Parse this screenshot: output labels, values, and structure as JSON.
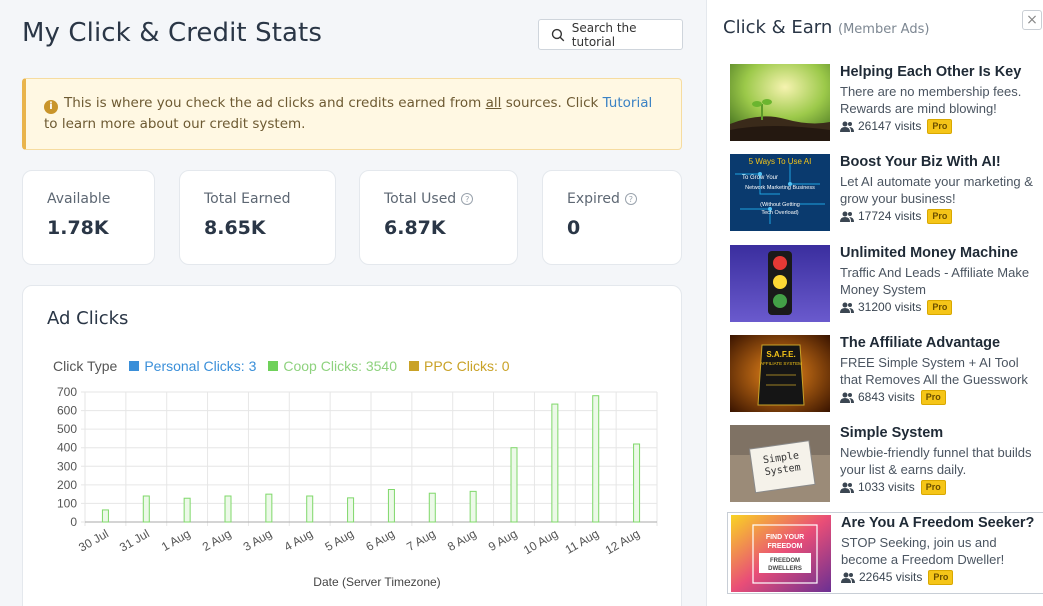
{
  "page": {
    "title": "My Click & Credit Stats"
  },
  "search": {
    "label": "Search the tutorial"
  },
  "alert": {
    "text_before": "This is where you check the ad clicks and credits earned from ",
    "underlined": "all",
    "text_mid": " sources. Click ",
    "link": "Tutorial",
    "text_after": " to learn more about our credit system."
  },
  "stats": [
    {
      "label": "Available",
      "value": "1.78K",
      "help": false
    },
    {
      "label": "Total Earned",
      "value": "8.65K",
      "help": false
    },
    {
      "label": "Total Used",
      "value": "6.87K",
      "help": true
    },
    {
      "label": "Expired",
      "value": "0",
      "help": true
    }
  ],
  "chart": {
    "title": "Ad Clicks",
    "legend_title": "Click Type",
    "legend": [
      {
        "label": "Personal Clicks: 3",
        "color": "#3a8fd9",
        "text_color": "#3a8fd9"
      },
      {
        "label": "Coop Clicks: 3540",
        "color": "#6fd15a",
        "text_color": "#8ed27e"
      },
      {
        "label": "PPC Clicks: 0",
        "color": "#c9a227",
        "text_color": "#c9a227"
      }
    ]
  },
  "chart_data": {
    "type": "bar",
    "categories": [
      "30 Jul",
      "31 Jul",
      "1 Aug",
      "2 Aug",
      "3 Aug",
      "4 Aug",
      "5 Aug",
      "6 Aug",
      "7 Aug",
      "8 Aug",
      "9 Aug",
      "10 Aug",
      "11 Aug",
      "12 Aug"
    ],
    "series": [
      {
        "name": "Personal Clicks",
        "values": [
          0,
          0,
          0,
          0,
          0,
          0,
          0,
          0,
          0,
          0,
          0,
          0,
          0,
          0
        ]
      },
      {
        "name": "Coop Clicks",
        "values": [
          65,
          140,
          128,
          140,
          150,
          140,
          130,
          175,
          155,
          165,
          400,
          635,
          680,
          420
        ]
      },
      {
        "name": "PPC Clicks",
        "values": [
          0,
          0,
          0,
          0,
          0,
          0,
          0,
          0,
          0,
          0,
          0,
          0,
          0,
          0
        ]
      }
    ],
    "xlabel": "Date (Server Timezone)",
    "ylabel": "",
    "ylim": [
      0,
      700
    ],
    "yticks": [
      0,
      100,
      200,
      300,
      400,
      500,
      600,
      700
    ],
    "grid": true
  },
  "sidebar": {
    "title": "Click & Earn",
    "subtitle": "(Member Ads)",
    "close": "×",
    "badge": "Pro",
    "ads": [
      {
        "title": "Helping Each Other Is Key",
        "desc": "There are no membership fees. Rewards are mind blowing!",
        "visits": "26147 visits"
      },
      {
        "title": "Boost Your Biz With AI!",
        "desc": "Let AI automate your marketing & grow your business!",
        "visits": "17724 visits",
        "thumb_text": [
          "5 Ways To Use AI",
          "To Grow Your",
          "Network Marketing Business",
          "(Without Getting",
          "Tech Overload)"
        ]
      },
      {
        "title": "Unlimited Money Machine",
        "desc": "Traffic And Leads - Affiliate Make Money System",
        "visits": "31200 visits"
      },
      {
        "title": "The Affiliate Advantage",
        "desc": "FREE Simple System + AI Tool that Removes All the Guesswork",
        "visits": "6843 visits",
        "thumb_text": [
          "S.A.F.E.",
          "AFFILIATE SYSTEM"
        ]
      },
      {
        "title": "Simple System",
        "desc": "Newbie-friendly funnel that builds your list & earns daily.",
        "visits": "1033 visits",
        "thumb_text": [
          "Simple",
          "System"
        ]
      },
      {
        "title": "Are You A Freedom Seeker?",
        "desc": "STOP Seeking, join us and become a Freedom Dweller!",
        "visits": "22645 visits",
        "thumb_text": [
          "FIND YOUR",
          "FREEDOM",
          "FREEDOM",
          "DWELLERS"
        ]
      }
    ]
  }
}
